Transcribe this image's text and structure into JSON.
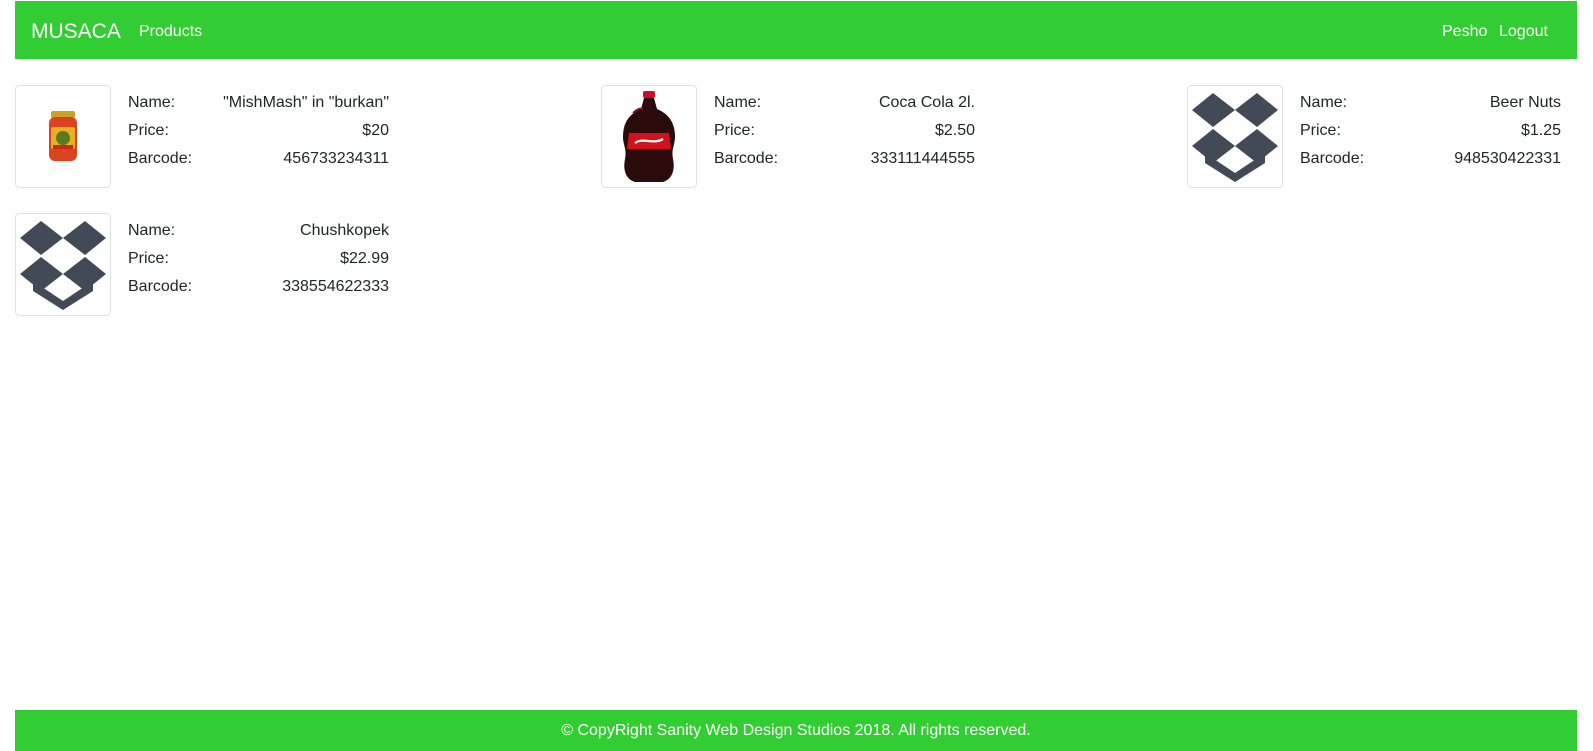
{
  "navbar": {
    "brand": "MUSACA",
    "products_link": "Products",
    "user": "Pesho",
    "logout": "Logout",
    "color": "#32cd32"
  },
  "products": [
    {
      "image": "jar-image",
      "name_label": "Name:",
      "name": "\"MishMash\" in \"burkan\"",
      "price_label": "Price:",
      "price": "$20",
      "barcode_label": "Barcode:",
      "barcode": "456733234311"
    },
    {
      "image": "cola-bottle-image",
      "name_label": "Name:",
      "name": "Coca Cola 2l.",
      "price_label": "Price:",
      "price": "$2.50",
      "barcode_label": "Barcode:",
      "barcode": "333111444555"
    },
    {
      "image": "box-icon",
      "name_label": "Name:",
      "name": "Beer Nuts",
      "price_label": "Price:",
      "price": "$1.25",
      "barcode_label": "Barcode:",
      "barcode": "948530422331"
    },
    {
      "image": "box-icon",
      "name_label": "Name:",
      "name": "Chushkopek",
      "price_label": "Price:",
      "price": "$22.99",
      "barcode_label": "Barcode:",
      "barcode": "338554622333"
    }
  ],
  "footer": {
    "text": "© CopyRight Sanity Web Design Studios 2018. All rights reserved."
  }
}
